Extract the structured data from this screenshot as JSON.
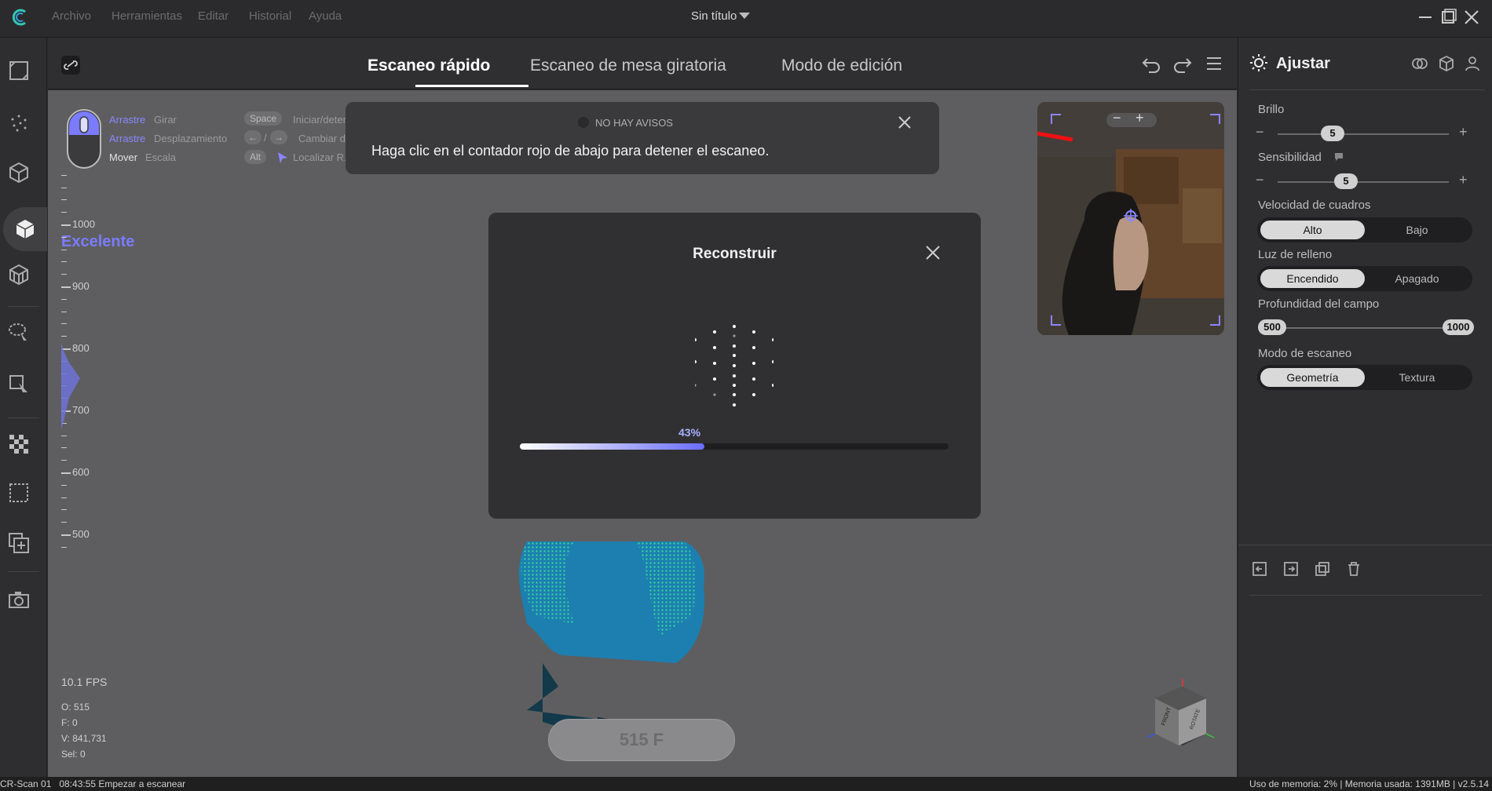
{
  "menu": {
    "items": [
      "Archivo",
      "Herramientas",
      "Editar",
      "Historial",
      "Ayuda"
    ],
    "document_title": "Sin título"
  },
  "tabs": {
    "quick_scan": "Escaneo rápido",
    "turntable_scan": "Escaneo de mesa giratoria",
    "edit_mode": "Modo de edición"
  },
  "right_panel": {
    "title": "Ajustar",
    "brightness": {
      "label": "Brillo",
      "value": "5"
    },
    "sensitivity": {
      "label": "Sensibilidad",
      "value": "5"
    },
    "frame_rate": {
      "label": "Velocidad de cuadros",
      "options": [
        "Alto",
        "Bajo"
      ],
      "selected": "Alto"
    },
    "fill_light": {
      "label": "Luz de relleno",
      "options": [
        "Encendido",
        "Apagado"
      ],
      "selected": "Encendido"
    },
    "depth_of_field": {
      "label": "Profundidad del campo",
      "min": "500",
      "max": "1000"
    },
    "scan_mode": {
      "label": "Modo de escaneo",
      "options": [
        "Geometría",
        "Textura"
      ],
      "selected": "Geometría"
    }
  },
  "mouse_hints": {
    "drag1": "Arrastre",
    "rotate": "Girar",
    "drag2": "Arrastre",
    "pan": "Desplazamiento",
    "move": "Mover",
    "scale": "Escala",
    "key_space": "Space",
    "space_action": "Iniciar/detener tarea",
    "switch_action": "Cambiar de ...",
    "key_alt": "Alt",
    "alt_action": "Localizar R.Center"
  },
  "notice": {
    "no_alerts": "NO HAY AVISOS",
    "message": "Haga clic en el contador rojo de abajo para detener el escaneo."
  },
  "dialog": {
    "title": "Reconstruir",
    "progress_label": "43%",
    "progress": 0.43
  },
  "quality": {
    "label": "Excelente",
    "ticks": [
      "1000",
      "900",
      "800",
      "700",
      "600",
      "500"
    ]
  },
  "stats": {
    "fps": "10.1 FPS",
    "o": "O: 515",
    "f": "F: 0",
    "v": "V: 841,731",
    "sel": "Sel: 0"
  },
  "counter": {
    "label": "515 F"
  },
  "statusbar": {
    "left": "CR-Scan 01   08:43:55 Empezar a escanear",
    "right": "Uso de memoria: 2% | Memoria usada: 1391MB | v2.5.14"
  },
  "colors": {
    "accent": "#7b7bff",
    "panel_bg": "#2e2e30",
    "viewport_bg": "#5e5e60"
  }
}
